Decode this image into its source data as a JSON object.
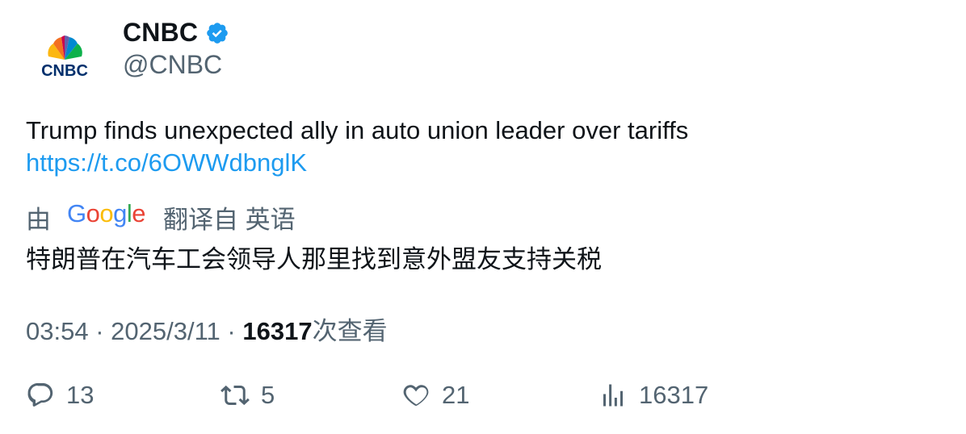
{
  "author": {
    "name": "CNBC",
    "handle": "@CNBC",
    "avatar_text": "CNBC",
    "verified_icon": "verified-badge-icon"
  },
  "tweet": {
    "text": "Trump finds unexpected ally in auto union leader over tariffs",
    "link": "https://t.co/6OWWdbnglK"
  },
  "translation": {
    "by_label": "由",
    "provider_logo_text": "Google",
    "translated_from_label": "翻译自 英语",
    "translated_text": "特朗普在汽车工会领导人那里找到意外盟友支持关税"
  },
  "meta": {
    "time": "03:54",
    "separator": "·",
    "date": "2025/3/11",
    "views_count": "16317",
    "views_label": "次查看"
  },
  "actions": {
    "replies": "13",
    "retweets": "5",
    "likes": "21",
    "views": "16317"
  },
  "colors": {
    "link": "#1d9bf0",
    "secondary_text": "#536471",
    "primary_text": "#0f1419",
    "verified": "#1d9bf0"
  }
}
